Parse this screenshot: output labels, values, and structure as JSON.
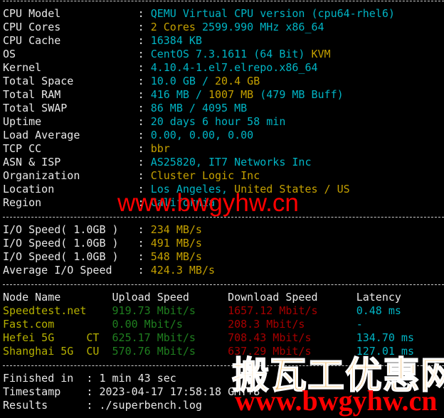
{
  "colors": {
    "label": "#e8e8e8",
    "cyan": "#00b4c4",
    "yellow": "#c4a000",
    "olive": "#b5b000",
    "green": "#1f7f1f",
    "red": "#a80000"
  },
  "system_info": [
    {
      "label": "CPU Model",
      "value": [
        {
          "text": "QEMU Virtual CPU version (cpu64-rhel6)",
          "color": "cyan"
        }
      ]
    },
    {
      "label": "CPU Cores",
      "value": [
        {
          "text": "2 Cores",
          "color": "yellow"
        },
        {
          "text": " 2599.990 MHz x86_64",
          "color": "cyan"
        }
      ]
    },
    {
      "label": "CPU Cache",
      "value": [
        {
          "text": "16384 KB",
          "color": "cyan"
        }
      ]
    },
    {
      "label": "OS",
      "value": [
        {
          "text": "CentOS 7.3.1611 (64 Bit)",
          "color": "cyan"
        },
        {
          "text": " KVM",
          "color": "yellow"
        }
      ]
    },
    {
      "label": "Kernel",
      "value": [
        {
          "text": "4.10.4-1.el7.elrepo.x86_64",
          "color": "cyan"
        }
      ]
    },
    {
      "label": "Total Space",
      "value": [
        {
          "text": "10.0 GB /",
          "color": "cyan"
        },
        {
          "text": " 20.4 GB",
          "color": "yellow"
        }
      ]
    },
    {
      "label": "Total RAM",
      "value": [
        {
          "text": "416 MB /",
          "color": "cyan"
        },
        {
          "text": " 1007 MB",
          "color": "yellow"
        },
        {
          "text": " (479 MB Buff)",
          "color": "cyan"
        }
      ]
    },
    {
      "label": "Total SWAP",
      "value": [
        {
          "text": "86 MB / 4095 MB",
          "color": "cyan"
        }
      ]
    },
    {
      "label": "Uptime",
      "value": [
        {
          "text": "20 days 6 hour 58 min",
          "color": "cyan"
        }
      ]
    },
    {
      "label": "Load Average",
      "value": [
        {
          "text": "0.00, 0.00, 0.00",
          "color": "cyan"
        }
      ]
    },
    {
      "label": "TCP CC",
      "value": [
        {
          "text": "bbr",
          "color": "yellow"
        }
      ]
    },
    {
      "label": "ASN & ISP",
      "value": [
        {
          "text": "AS25820, IT7 Networks Inc",
          "color": "cyan"
        }
      ]
    },
    {
      "label": "Organization",
      "value": [
        {
          "text": "Cluster Logic Inc",
          "color": "yellow"
        }
      ]
    },
    {
      "label": "Location",
      "value": [
        {
          "text": "Los Angeles,",
          "color": "cyan"
        },
        {
          "text": " United States / US",
          "color": "yellow"
        }
      ]
    },
    {
      "label": "Region",
      "value": [
        {
          "text": "California",
          "color": "cyan"
        }
      ]
    }
  ],
  "io_speed": [
    {
      "label": "I/O Speed( 1.0GB )",
      "value": "234 MB/s"
    },
    {
      "label": "I/O Speed( 1.0GB )",
      "value": "491 MB/s"
    },
    {
      "label": "I/O Speed( 1.0GB )",
      "value": "548 MB/s"
    },
    {
      "label": "Average I/O Speed",
      "value": "424.3 MB/s"
    }
  ],
  "speedtest": {
    "headers": [
      "Node Name",
      "Upload Speed",
      "Download Speed",
      "Latency"
    ],
    "rows": [
      {
        "node": "Speedtest.net",
        "isp": "",
        "upload": "919.73 Mbit/s",
        "download": "1657.12 Mbit/s",
        "latency": "0.48 ms"
      },
      {
        "node": "Fast.com",
        "isp": "",
        "upload": "0.00 Mbit/s",
        "download": "208.3 Mbit/s",
        "latency": "-"
      },
      {
        "node": "Hefei 5G",
        "isp": "CT",
        "upload": "625.17 Mbit/s",
        "download": "708.43 Mbit/s",
        "latency": "134.70 ms"
      },
      {
        "node": "Shanghai 5G",
        "isp": "CU",
        "upload": "570.76 Mbit/s",
        "download": "637.29 Mbit/s",
        "latency": "127.01 ms"
      }
    ]
  },
  "summary": [
    {
      "label": "Finished in",
      "value": "1 min 43 sec"
    },
    {
      "label": "Timestamp",
      "value": "2023-04-17 17:58:18 GMT+8"
    },
    {
      "label": "Results",
      "value": "./superbench.log"
    }
  ],
  "watermarks": {
    "url_center": "www.bwgyhw.cn",
    "brand_cn": "搬瓦工优惠网",
    "url_corner": "www.bwgyhw.cn"
  }
}
